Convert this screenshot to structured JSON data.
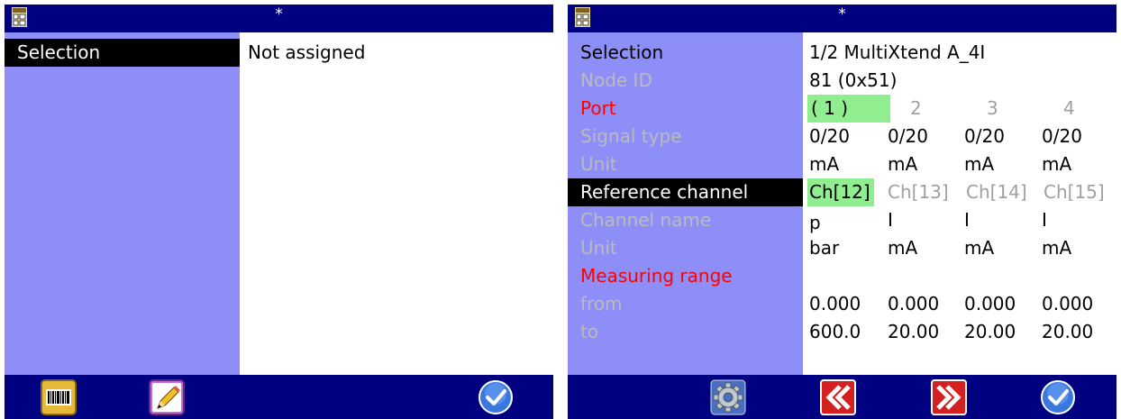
{
  "colors": {
    "titlebar": "#000080",
    "label_panel": "#8e8ef9",
    "selected_row": "#000000",
    "highlight": "#90ee90",
    "red_label": "#ff0000",
    "dim_label": "#bbbbbb"
  },
  "left": {
    "title": "*",
    "app_icon": "module-config-icon",
    "rows": [
      {
        "label": "Selection",
        "value": "Not assigned"
      }
    ],
    "toolbar": [
      "barcode-icon",
      "edit-pen-icon",
      "confirm-check-icon"
    ]
  },
  "right": {
    "title": "*",
    "app_icon": "module-config-icon",
    "selection": {
      "label": "Selection",
      "value": "1/2 MultiXtend A_4I"
    },
    "node_id": {
      "label": "Node ID",
      "value": "81 (0x51)"
    },
    "port": {
      "label": "Port",
      "values": [
        "( 1 )",
        "2",
        "3",
        "4"
      ]
    },
    "signal_type": {
      "label": "Signal type",
      "values": [
        "0/20",
        "0/20",
        "0/20",
        "0/20"
      ]
    },
    "unit1": {
      "label": "Unit",
      "values": [
        "mA",
        "mA",
        "mA",
        "mA"
      ]
    },
    "reference_channel": {
      "label": "Reference channel",
      "values": [
        "Ch[12]",
        "Ch[13]",
        "Ch[14]",
        "Ch[15]"
      ]
    },
    "channel_name": {
      "label": "Channel name",
      "values": [
        "p",
        "I",
        "I",
        "I"
      ]
    },
    "unit2": {
      "label": "Unit",
      "values": [
        "bar",
        "mA",
        "mA",
        "mA"
      ]
    },
    "measuring_range": {
      "label": "Measuring range"
    },
    "from": {
      "label": "from",
      "values": [
        "0.000",
        "0.000",
        "0.000",
        "0.000"
      ]
    },
    "to": {
      "label": "to",
      "values": [
        "600.0",
        "20.00",
        "20.00",
        "20.00"
      ]
    },
    "toolbar": [
      "settings-gear-icon",
      "rewind-back-icon",
      "fast-forward-icon",
      "confirm-check-icon"
    ]
  }
}
